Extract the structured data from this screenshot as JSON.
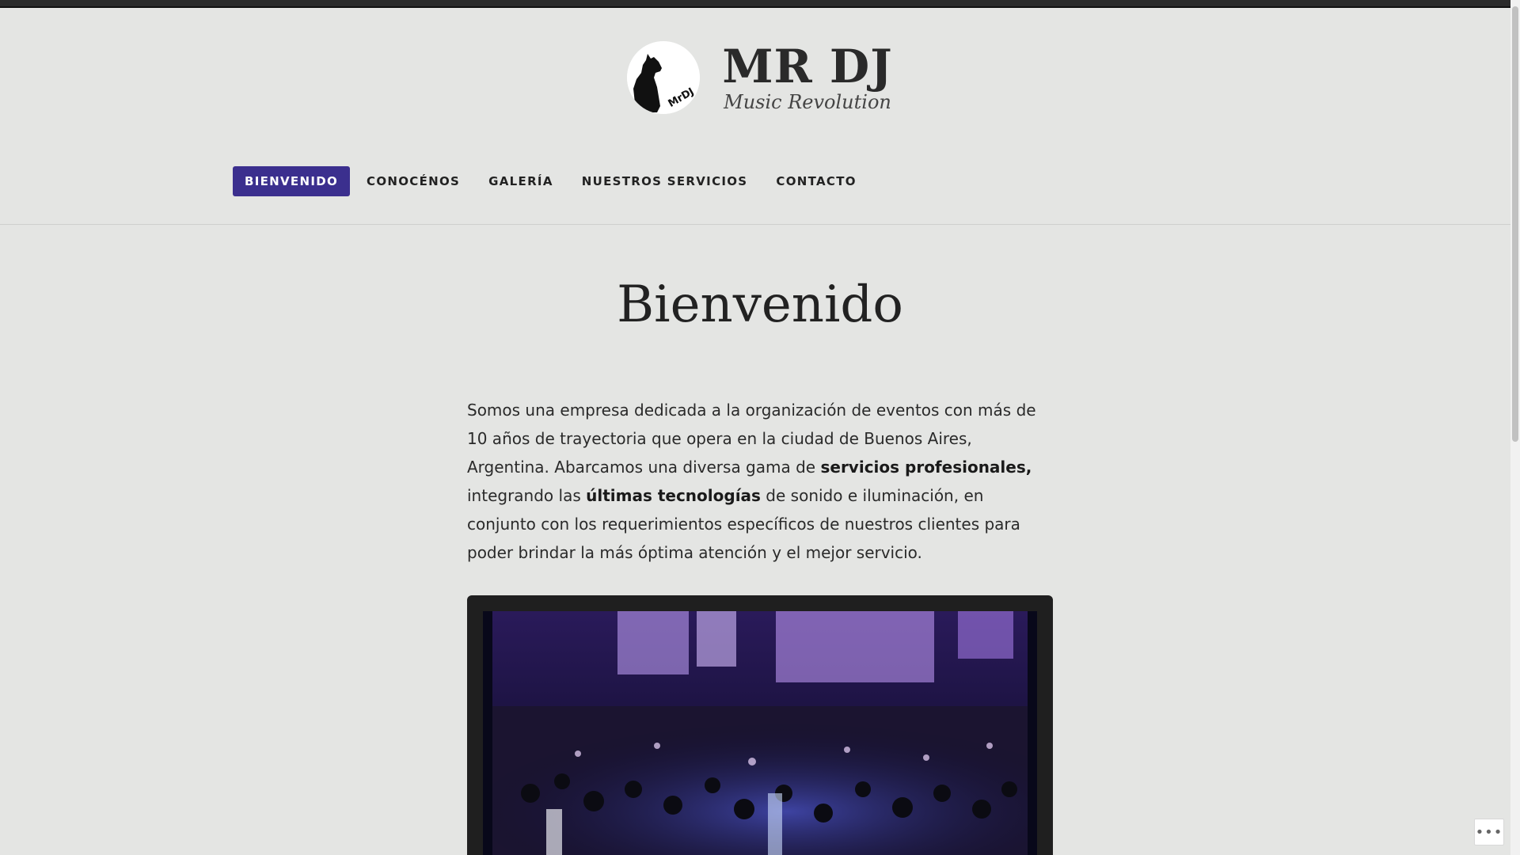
{
  "header": {
    "site_title": "MR DJ",
    "tagline": "Music Revolution",
    "logo_text": "MrDJ"
  },
  "nav": {
    "items": [
      {
        "label": "BIENVENIDO",
        "active": true
      },
      {
        "label": "CONOCÉNOS",
        "active": false
      },
      {
        "label": "GALERÍA",
        "active": false
      },
      {
        "label": "NUESTROS SERVICIOS",
        "active": false
      },
      {
        "label": "CONTACTO",
        "active": false
      }
    ]
  },
  "main": {
    "title": "Bienvenido",
    "intro_part1": "Somos una empresa dedicada a la organización de eventos con más de 10 años de trayectoria que opera en la ciudad de Buenos Aires, Argentina. Abarcamos una diversa gama de ",
    "intro_bold1": "servicios profesionales,",
    "intro_part2": " integrando las ",
    "intro_bold2": "últimas tecnologías",
    "intro_part3": " de sonido e iluminación, en conjunto con los requerimientos específicos de nuestros clientes para poder brindar la más óptima atención y el mejor servicio."
  },
  "colors": {
    "background": "#e4e5e3",
    "nav_active": "#3b2f8e",
    "text": "#222222"
  },
  "icons": {
    "more": "ellipsis-icon"
  },
  "more_button_label": "•••"
}
